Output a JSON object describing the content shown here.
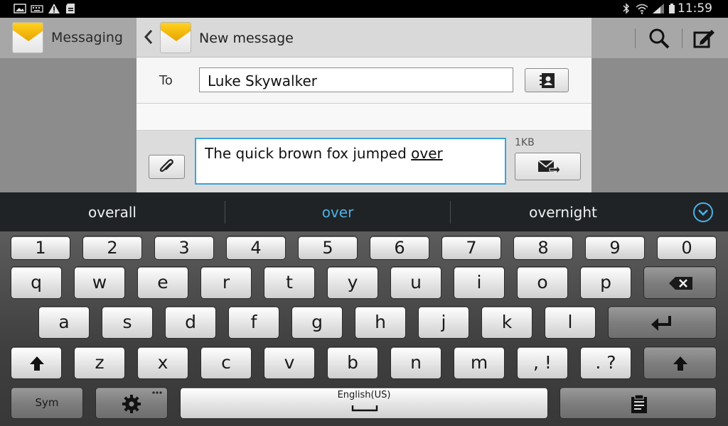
{
  "status_bar": {
    "time": "11:59",
    "left_icons": [
      "image-icon",
      "keyboard-icon",
      "warning-icon",
      "sd-card-icon"
    ],
    "right_icons": [
      "bluetooth-icon",
      "wifi-icon",
      "signal-icon",
      "battery-icon"
    ]
  },
  "action_bar": {
    "app_title": "Messaging",
    "search_icon": "search-icon",
    "compose_icon": "compose-icon"
  },
  "compose": {
    "title": "New message",
    "to_label": "To",
    "to_value": "Luke Skywalker",
    "message_prefix": "The quick brown fox jumped ",
    "message_word": "over",
    "size_label": "1KB"
  },
  "suggestions": [
    "overall",
    "over",
    "overnight"
  ],
  "keyboard": {
    "numbers": [
      "1",
      "2",
      "3",
      "4",
      "5",
      "6",
      "7",
      "8",
      "9",
      "0"
    ],
    "row1": [
      "q",
      "w",
      "e",
      "r",
      "t",
      "y",
      "u",
      "i",
      "o",
      "p"
    ],
    "row2": [
      "a",
      "s",
      "d",
      "f",
      "g",
      "h",
      "j",
      "k",
      "l"
    ],
    "row3": [
      "z",
      "x",
      "c",
      "v",
      "b",
      "n",
      "m"
    ],
    "comma_key": ", !",
    "period_key": ". ?",
    "sym_label": "Sym",
    "language_label": "English(US)"
  },
  "colors": {
    "accent": "#4cb0e6",
    "suggestion_bar": "#1f2326",
    "envelope_flap": "#ffd21e"
  }
}
